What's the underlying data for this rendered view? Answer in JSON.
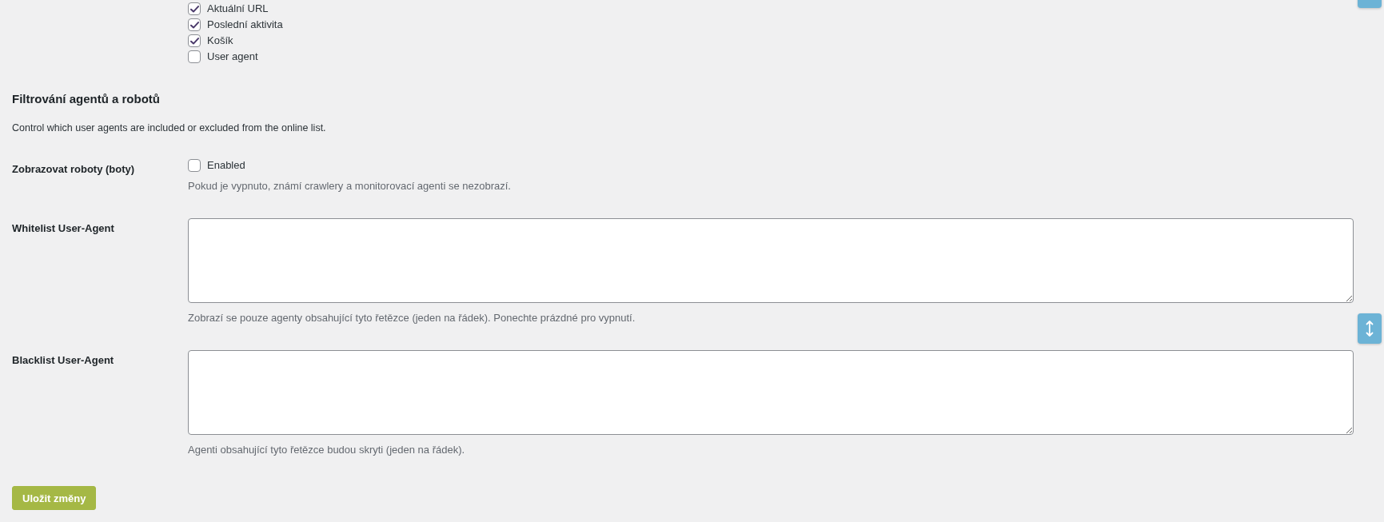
{
  "columns": [
    {
      "label": "Aktuální URL",
      "checked": true
    },
    {
      "label": "Poslední aktivita",
      "checked": true
    },
    {
      "label": "Košík",
      "checked": true
    },
    {
      "label": "User agent",
      "checked": false
    }
  ],
  "section": {
    "title": "Filtrování agentů a robotů",
    "description": "Control which user agents are included or excluded from the online list."
  },
  "fields": [
    {
      "kind": "checkbox",
      "label": "Zobrazovat roboty (boty)",
      "option": "Enabled",
      "checked": false,
      "help": "Pokud je vypnuto, známí crawlery a monitorovací agenti se nezobrazí."
    },
    {
      "kind": "textarea",
      "label": "Whitelist User-Agent",
      "help": "Zobrazí se pouze agenty obsahující tyto řetězce (jeden na řádek). Ponechte prázdné pro vypnutí."
    },
    {
      "kind": "textarea",
      "label": "Blacklist User-Agent",
      "help": "Agenti obsahující tyto řetězce budou skryti (jeden na řádek)."
    }
  ],
  "save_button": "Uložit změny"
}
